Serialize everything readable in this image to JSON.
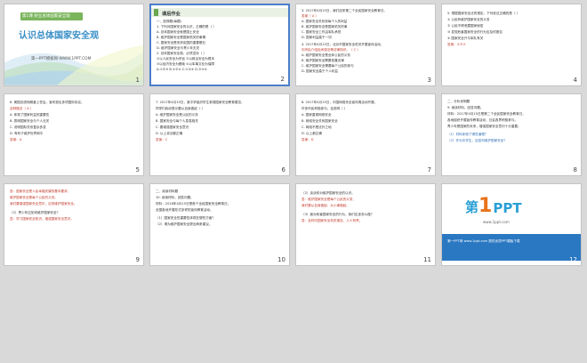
{
  "slides": [
    {
      "number": "1",
      "lesson": "第1课  树立总体国家安全观",
      "title": "认识总体国家安全观",
      "footer": "第一PPT模板网-WWW.1PPT.COM"
    },
    {
      "number": "2",
      "heading": "课后作业",
      "lines": [
        "一、选择题(每题)",
        "1. 下列对国家安全的认识，正确的是（  ）",
        "A. 总体国家安全就是国土安全",
        "B. 维护国家安全是国家机关的事情",
        "C. 国家安全是安邦定国的重要基石",
        "D. 维护国家安全与青少年无关",
        "2. 总体国家安全观，必须坚持（  ）",
        "①以人民安全为宗旨 ②以政治安全为根本",
        "③以经济安全为基础 ④以军事文化为保障",
        "A.①②③  B.①②④  C.①③④  D.②③④"
      ]
    },
    {
      "number": "3",
      "lines": [
        "3. 2017年4月15日，我们迎来第二个全民国家安全教育日。",
        "答案（ A ）",
        "A. 国家安全关系到每个人的利益",
        "B. 维护国家安全是国家机关的事",
        "C. 国家安全工作由军队承担",
        "D. 国家利益高于一切",
        "4. 2017年4月15日，北京市国家安全机关开展宣传活动，",
        "向市民介绍反间谍法等法律知识。（ C ）",
        "A. 维护国家安全是全体公民的义务",
        "B. 维护国家安全需要依靠法律",
        "C. 维护国家安全需要每个公民的参与",
        "D. 国家安全高于个人利益"
      ]
    },
    {
      "number": "4",
      "lines": [
        "5. 根据国家安全法的规定，下列说法正确的是（  ）",
        "① 公民有维护国家安全的义务",
        "② 公民不得泄露国家秘密",
        "③ 发现危害国家安全的行为应及时报告",
        "④ 国家安全只与军队有关",
        "答案：①②③"
      ]
    },
    {
      "number": "5",
      "lines": [
        "6. 美国总统特朗普上任后，宣布退出多项国际协议，",
        "这种做法（ A ）",
        "A. 体现了国家利益的重要性",
        "B. 表明国家安全与个人无关",
        "C. 说明国际关系复杂多变",
        "D. 有利于维护世界和平",
        "答案：A"
      ]
    },
    {
      "number": "6",
      "lines": [
        "7. 2017年4月15日，某中学组织学生参观国家安全教育展览，",
        "同学们纷纷表示要从自身做起（  ）",
        "A. 维护国家安全是公民的义务",
        "B. 国家安全与每个人息息相关",
        "C. 要增强国家安全意识",
        "D. 以上说法都正确",
        "答案：C"
      ]
    },
    {
      "number": "7",
      "lines": [
        "8. 2017年4月15日，中国网络安全宣传周活动开展，",
        "许多市民积极参与。这说明（  ）",
        "A. 国家重视网络安全",
        "B. 网络安全关系国家安全",
        "C. 网络不是法外之地",
        "D. 以上都正确",
        "答案：D"
      ]
    },
    {
      "number": "8",
      "lines": [
        "二、分析说明题",
        "9. 阅读材料，回答问题。",
        "材料：2017年4月15日是第二个全民国家安全教育日，",
        "各地组织开展宣传教育活动，社会各界积极参与。",
        "青少年是国家的未来，增强国家安全意识十分重要。",
        "（1）材料体现了哪些道理？",
        "（2）作为中学生，应如何维护国家安全？"
      ]
    },
    {
      "number": "9",
      "lines": [
        "答：国家安全是人民幸福安康的基本要求，",
        "维护国家安全是每个公民的义务。",
        "我们要增强国家安全意识，自觉维护国家安全。",
        "（2）青少年应如何维护国家安全？",
        "答：学习国家安全知识，增强国家安全意识。"
      ]
    },
    {
      "number": "10",
      "lines": [
        "二、阅读材料题",
        "10. 阅读材料，回答问题。",
        "材料：2016年4月15日是首个全民国家安全教育日，",
        "全国各地开展形式多样的宣传教育活动。",
        "（1）国家安全的重要性体现在哪些方面？",
        "（2）请为维护国家安全提出两条建议。"
      ]
    },
    {
      "number": "11",
      "lines": [
        "（2）谈谈你对维护国家安全的认识。",
        "答：维护国家安全是每个公民的义务，",
        "我们要从自身做起，从小事做起。",
        "（3）面对危害国家安全的行为，我们应该怎么做？",
        "答：及时向国家安全机关报告，人人有责。"
      ]
    },
    {
      "number": "12",
      "logo_prefix": "第",
      "logo_digit": "1",
      "logo_suffix": "PPT",
      "logo_sub": "www.1ppt.com",
      "banner": "第一PPT网 www.1ppt.com 提供优质PPT模板下载"
    }
  ]
}
